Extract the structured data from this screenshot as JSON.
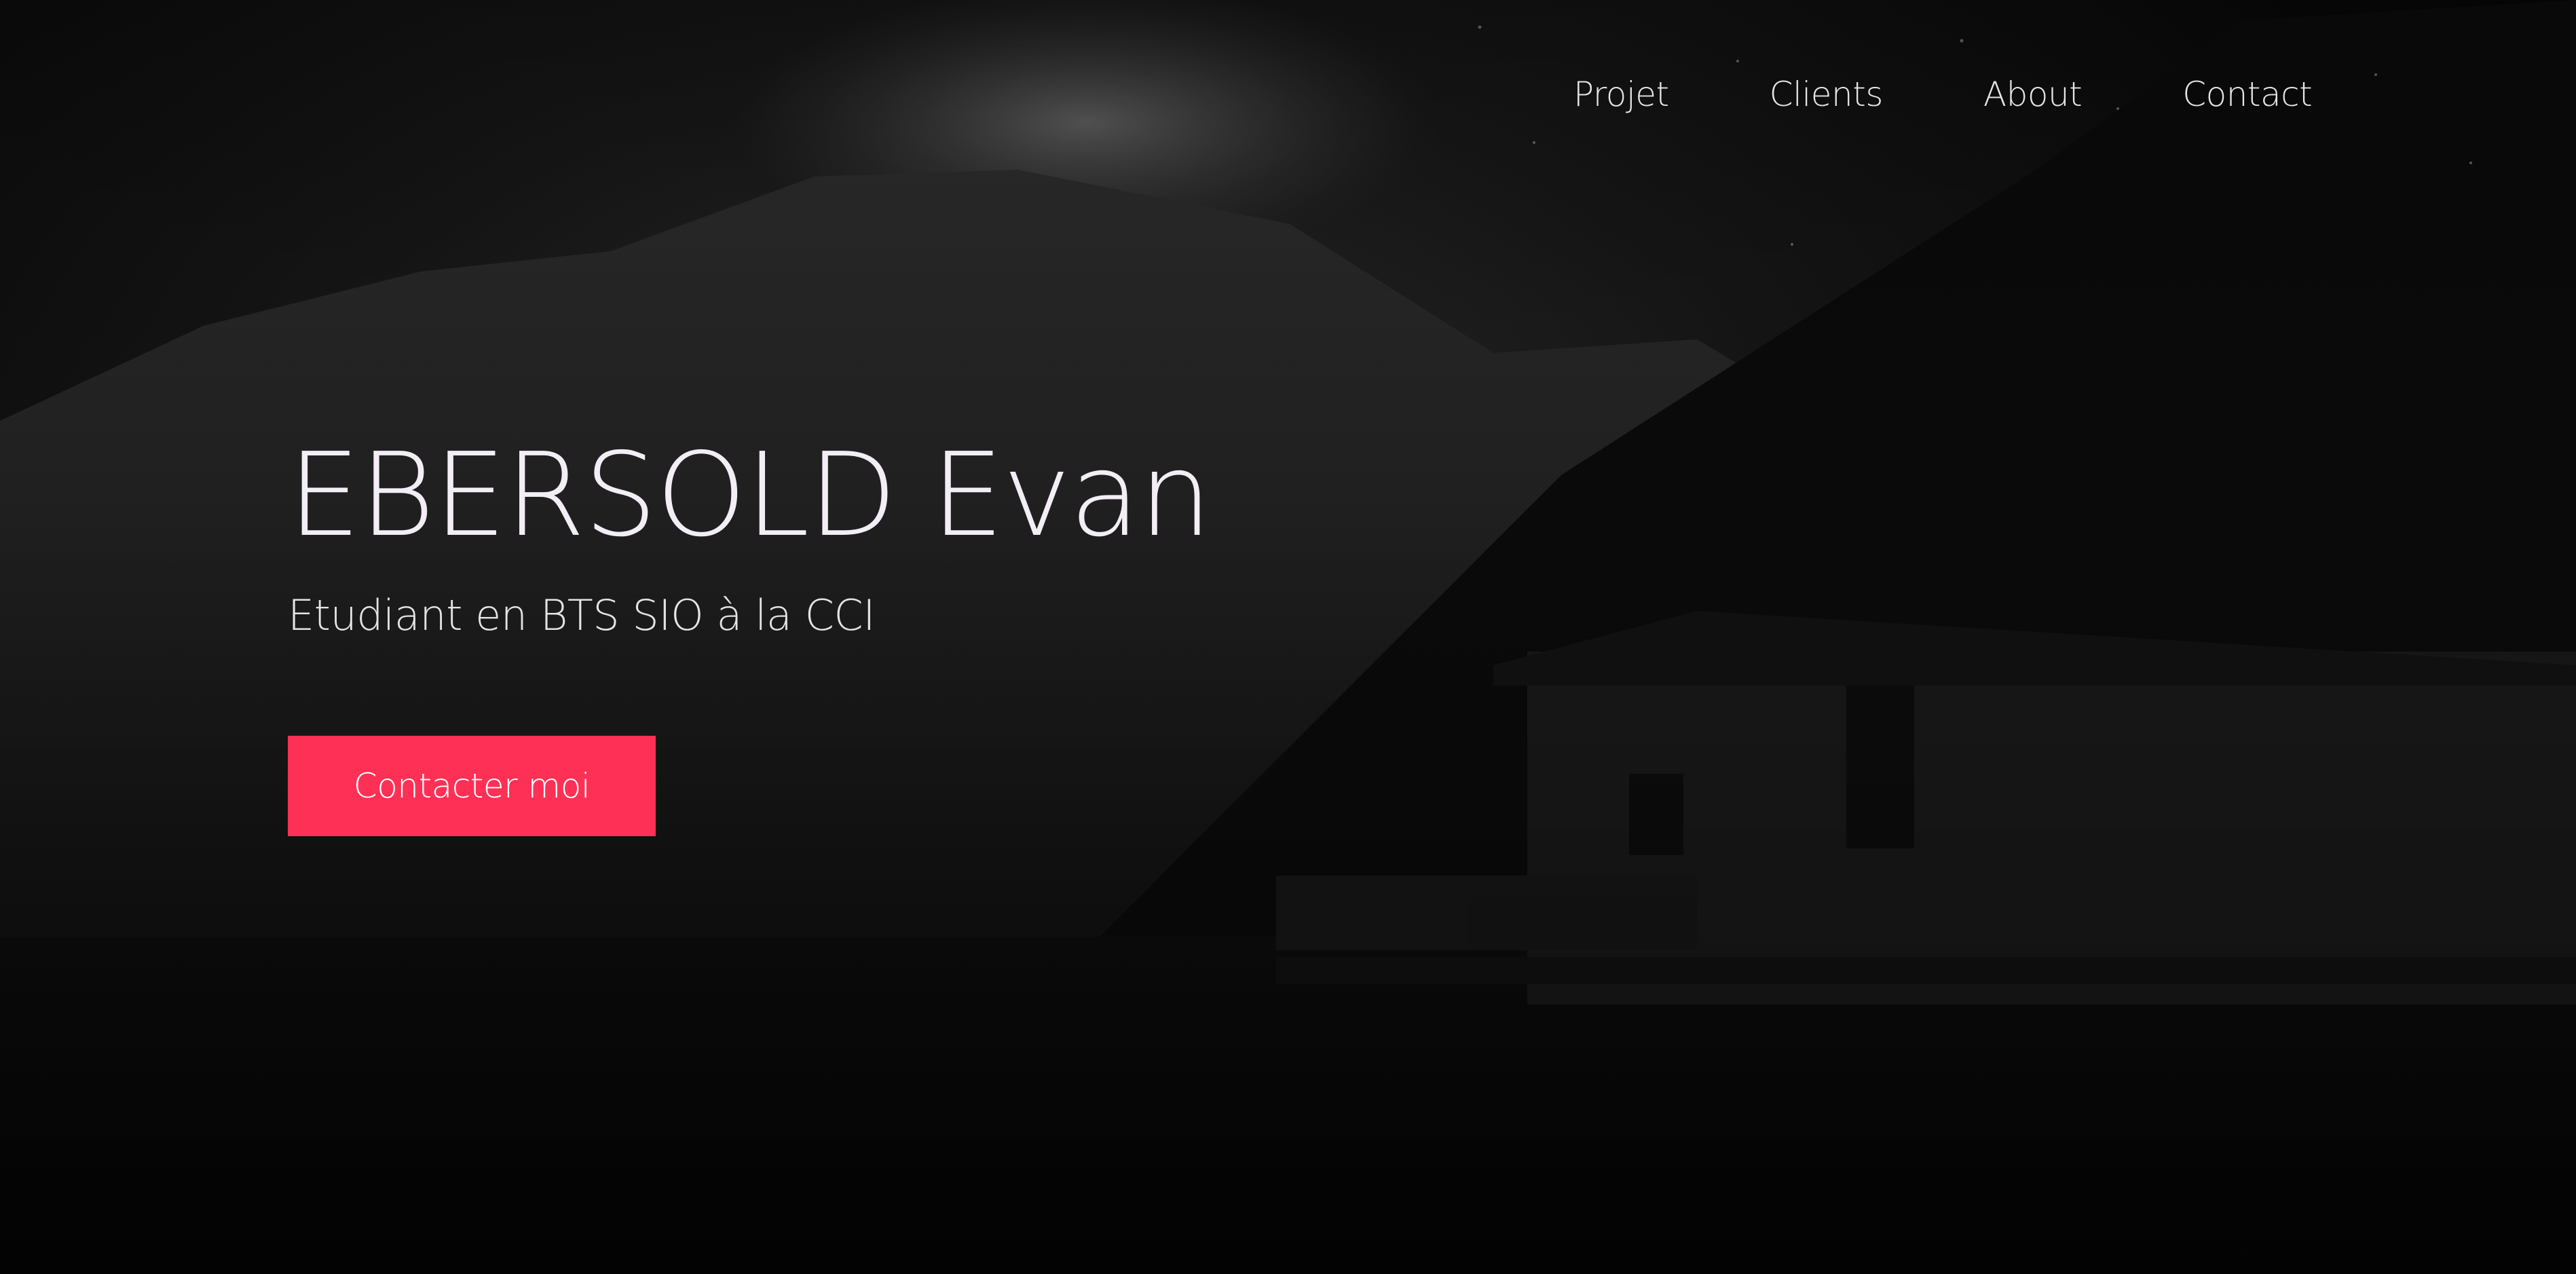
{
  "nav": {
    "items": [
      {
        "label": "Projet"
      },
      {
        "label": "Clients"
      },
      {
        "label": "About"
      },
      {
        "label": "Contact"
      }
    ]
  },
  "hero": {
    "title": "EBERSOLD Evan",
    "subtitle": "Etudiant en BTS SIO à la CCI",
    "cta_label": "Contacter moi"
  },
  "colors": {
    "accent": "#ff3055",
    "text": "#f3eef6",
    "background": "#050505"
  }
}
